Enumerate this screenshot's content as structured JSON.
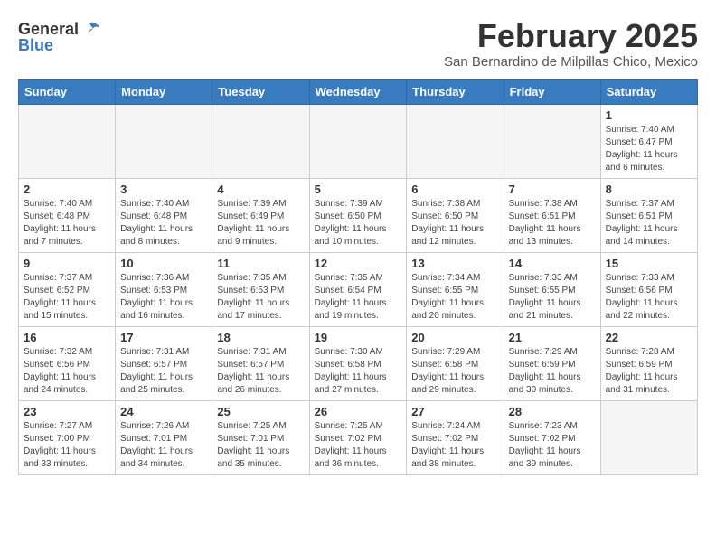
{
  "header": {
    "logo_general": "General",
    "logo_blue": "Blue",
    "month_title": "February 2025",
    "location": "San Bernardino de Milpillas Chico, Mexico"
  },
  "weekdays": [
    "Sunday",
    "Monday",
    "Tuesday",
    "Wednesday",
    "Thursday",
    "Friday",
    "Saturday"
  ],
  "weeks": [
    {
      "days": [
        {
          "date": "",
          "info": ""
        },
        {
          "date": "",
          "info": ""
        },
        {
          "date": "",
          "info": ""
        },
        {
          "date": "",
          "info": ""
        },
        {
          "date": "",
          "info": ""
        },
        {
          "date": "",
          "info": ""
        },
        {
          "date": "1",
          "info": "Sunrise: 7:40 AM\nSunset: 6:47 PM\nDaylight: 11 hours and 6 minutes."
        }
      ]
    },
    {
      "days": [
        {
          "date": "2",
          "info": "Sunrise: 7:40 AM\nSunset: 6:48 PM\nDaylight: 11 hours and 7 minutes."
        },
        {
          "date": "3",
          "info": "Sunrise: 7:40 AM\nSunset: 6:48 PM\nDaylight: 11 hours and 8 minutes."
        },
        {
          "date": "4",
          "info": "Sunrise: 7:39 AM\nSunset: 6:49 PM\nDaylight: 11 hours and 9 minutes."
        },
        {
          "date": "5",
          "info": "Sunrise: 7:39 AM\nSunset: 6:50 PM\nDaylight: 11 hours and 10 minutes."
        },
        {
          "date": "6",
          "info": "Sunrise: 7:38 AM\nSunset: 6:50 PM\nDaylight: 11 hours and 12 minutes."
        },
        {
          "date": "7",
          "info": "Sunrise: 7:38 AM\nSunset: 6:51 PM\nDaylight: 11 hours and 13 minutes."
        },
        {
          "date": "8",
          "info": "Sunrise: 7:37 AM\nSunset: 6:51 PM\nDaylight: 11 hours and 14 minutes."
        }
      ]
    },
    {
      "days": [
        {
          "date": "9",
          "info": "Sunrise: 7:37 AM\nSunset: 6:52 PM\nDaylight: 11 hours and 15 minutes."
        },
        {
          "date": "10",
          "info": "Sunrise: 7:36 AM\nSunset: 6:53 PM\nDaylight: 11 hours and 16 minutes."
        },
        {
          "date": "11",
          "info": "Sunrise: 7:35 AM\nSunset: 6:53 PM\nDaylight: 11 hours and 17 minutes."
        },
        {
          "date": "12",
          "info": "Sunrise: 7:35 AM\nSunset: 6:54 PM\nDaylight: 11 hours and 19 minutes."
        },
        {
          "date": "13",
          "info": "Sunrise: 7:34 AM\nSunset: 6:55 PM\nDaylight: 11 hours and 20 minutes."
        },
        {
          "date": "14",
          "info": "Sunrise: 7:33 AM\nSunset: 6:55 PM\nDaylight: 11 hours and 21 minutes."
        },
        {
          "date": "15",
          "info": "Sunrise: 7:33 AM\nSunset: 6:56 PM\nDaylight: 11 hours and 22 minutes."
        }
      ]
    },
    {
      "days": [
        {
          "date": "16",
          "info": "Sunrise: 7:32 AM\nSunset: 6:56 PM\nDaylight: 11 hours and 24 minutes."
        },
        {
          "date": "17",
          "info": "Sunrise: 7:31 AM\nSunset: 6:57 PM\nDaylight: 11 hours and 25 minutes."
        },
        {
          "date": "18",
          "info": "Sunrise: 7:31 AM\nSunset: 6:57 PM\nDaylight: 11 hours and 26 minutes."
        },
        {
          "date": "19",
          "info": "Sunrise: 7:30 AM\nSunset: 6:58 PM\nDaylight: 11 hours and 27 minutes."
        },
        {
          "date": "20",
          "info": "Sunrise: 7:29 AM\nSunset: 6:58 PM\nDaylight: 11 hours and 29 minutes."
        },
        {
          "date": "21",
          "info": "Sunrise: 7:29 AM\nSunset: 6:59 PM\nDaylight: 11 hours and 30 minutes."
        },
        {
          "date": "22",
          "info": "Sunrise: 7:28 AM\nSunset: 6:59 PM\nDaylight: 11 hours and 31 minutes."
        }
      ]
    },
    {
      "days": [
        {
          "date": "23",
          "info": "Sunrise: 7:27 AM\nSunset: 7:00 PM\nDaylight: 11 hours and 33 minutes."
        },
        {
          "date": "24",
          "info": "Sunrise: 7:26 AM\nSunset: 7:01 PM\nDaylight: 11 hours and 34 minutes."
        },
        {
          "date": "25",
          "info": "Sunrise: 7:25 AM\nSunset: 7:01 PM\nDaylight: 11 hours and 35 minutes."
        },
        {
          "date": "26",
          "info": "Sunrise: 7:25 AM\nSunset: 7:02 PM\nDaylight: 11 hours and 36 minutes."
        },
        {
          "date": "27",
          "info": "Sunrise: 7:24 AM\nSunset: 7:02 PM\nDaylight: 11 hours and 38 minutes."
        },
        {
          "date": "28",
          "info": "Sunrise: 7:23 AM\nSunset: 7:02 PM\nDaylight: 11 hours and 39 minutes."
        },
        {
          "date": "",
          "info": ""
        }
      ]
    }
  ]
}
